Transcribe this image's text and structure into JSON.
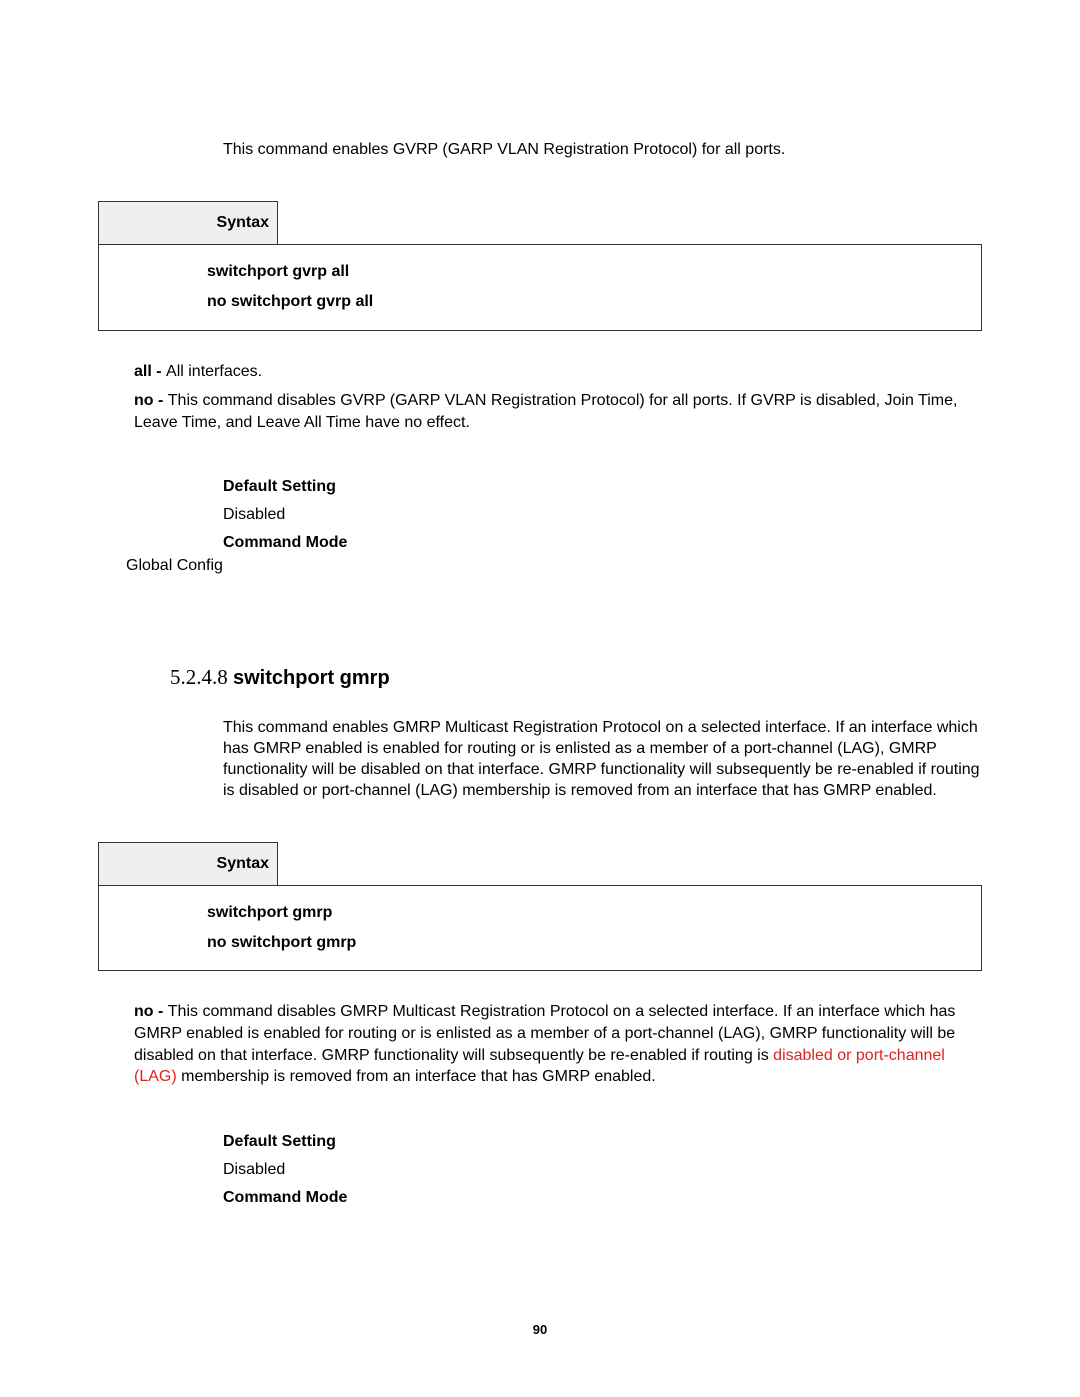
{
  "section1": {
    "intro": "This command enables GVRP (GARP VLAN Registration Protocol) for all ports.",
    "syntax_label": "Syntax",
    "syntax_line1": "switchport gvrp all",
    "syntax_line2": "no switchport gvrp all",
    "all_bold": "all - ",
    "all_text": "All interfaces.",
    "no_bold": "no - ",
    "no_text": "This command disables GVRP (GARP VLAN Registration Protocol) for all ports. If GVRP is disabled, Join Time, Leave Time, and Leave All Time have no effect.",
    "default_setting_label": "Default Setting",
    "default_setting_value": "Disabled",
    "command_mode_label": "Command Mode",
    "command_mode_value": "Global Config"
  },
  "section2": {
    "heading_num": "5.2.4.8 ",
    "heading_title": "switchport gmrp",
    "intro": "This command enables GMRP Multicast Registration Protocol on a selected interface. If an interface which has GMRP enabled is enabled for routing or is enlisted as a member of a port-channel (LAG), GMRP functionality will be disabled on that interface. GMRP functionality will subsequently be re-enabled if routing is disabled or port-channel (LAG) membership is removed from an interface that has GMRP enabled.",
    "syntax_label": "Syntax",
    "syntax_line1": "switchport gmrp",
    "syntax_line2": "no switchport gmrp",
    "no_bold": "no - ",
    "no_text_a": "This command disables GMRP Multicast Registration Protocol on a selected interface. If an interface which has GMRP enabled is enabled for routing or is enlisted as a member of a port-channel (LAG), GMRP functionality will be disabled on that interface. GMRP functionality will subsequently be re-enabled if routing is ",
    "no_text_red": "disabled or port-channel (LAG)",
    "no_text_b": " membership is removed from an interface that has GMRP enabled.",
    "default_setting_label": "Default Setting",
    "default_setting_value": "Disabled",
    "command_mode_label": "Command Mode"
  },
  "page_number": "90"
}
